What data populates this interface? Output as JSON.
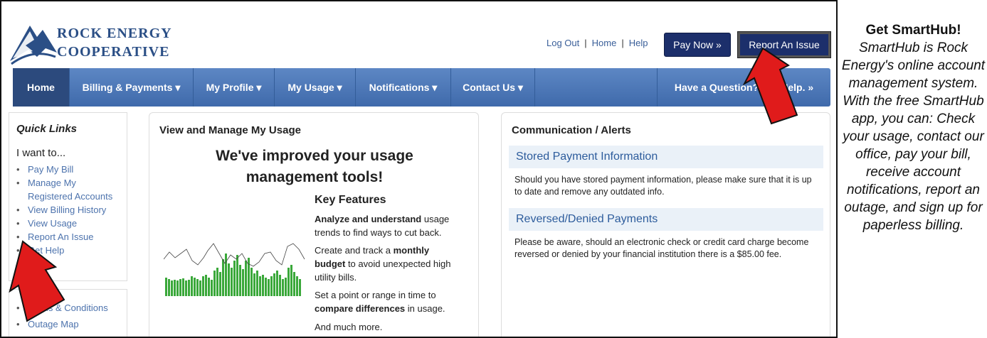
{
  "logo": {
    "line1": "ROCK ENERGY",
    "line2": "COOPERATIVE"
  },
  "header": {
    "links": [
      "Log Out",
      "Home",
      "Help"
    ],
    "pay_now": "Pay Now »",
    "report_issue": "Report An Issue"
  },
  "nav": {
    "items": [
      "Home",
      "Billing & Payments ▾",
      "My Profile ▾",
      "My Usage ▾",
      "Notifications ▾",
      "Contact Us ▾"
    ],
    "help": "Have a Question? Get Help. »"
  },
  "quick_links": {
    "title": "Quick Links",
    "intro": "I want to...",
    "items": [
      "Pay My Bill",
      "Manage My Registered Accounts",
      "View Billing History",
      "View Usage",
      "Report An Issue",
      "Get Help"
    ],
    "items2": [
      "Terms & Conditions",
      "Outage Map"
    ]
  },
  "usage_panel": {
    "title": "View and Manage My Usage",
    "headline": "We've improved your usage management tools!",
    "features_title": "Key Features",
    "f1_bold": "Analyze and understand",
    "f1_rest": " usage trends to find ways to cut back.",
    "f2_pre": "Create and track a ",
    "f2_bold": "monthly budget",
    "f2_rest": " to avoid unexpected high utility bills.",
    "f3_pre": "Set a point or range in time to ",
    "f3_bold": "compare differences",
    "f3_rest": " in usage.",
    "f4": "And much more."
  },
  "alerts_panel": {
    "title": "Communication / Alerts",
    "s1_title": "Stored Payment Information",
    "s1_text": "Should you have stored payment information, please make sure that it is up to date and remove any outdated info.",
    "s2_title": "Reversed/Denied Payments",
    "s2_text": "Please be aware, should an electronic check or credit card charge become reversed or denied by your financial institution there is a $85.00 fee."
  },
  "side": {
    "title": "Get SmartHub!",
    "body": "SmartHub is Rock Energy's online account management system. With the free SmartHub app, you can: Check your usage, contact our office, pay your bill, receive account notifications, report an outage, and sign up for paperless billing."
  },
  "colors": {
    "brand": "#2b4f86",
    "nav": "#4a74b6",
    "button": "#1c2f6b",
    "arrow": "#e01b1b"
  }
}
